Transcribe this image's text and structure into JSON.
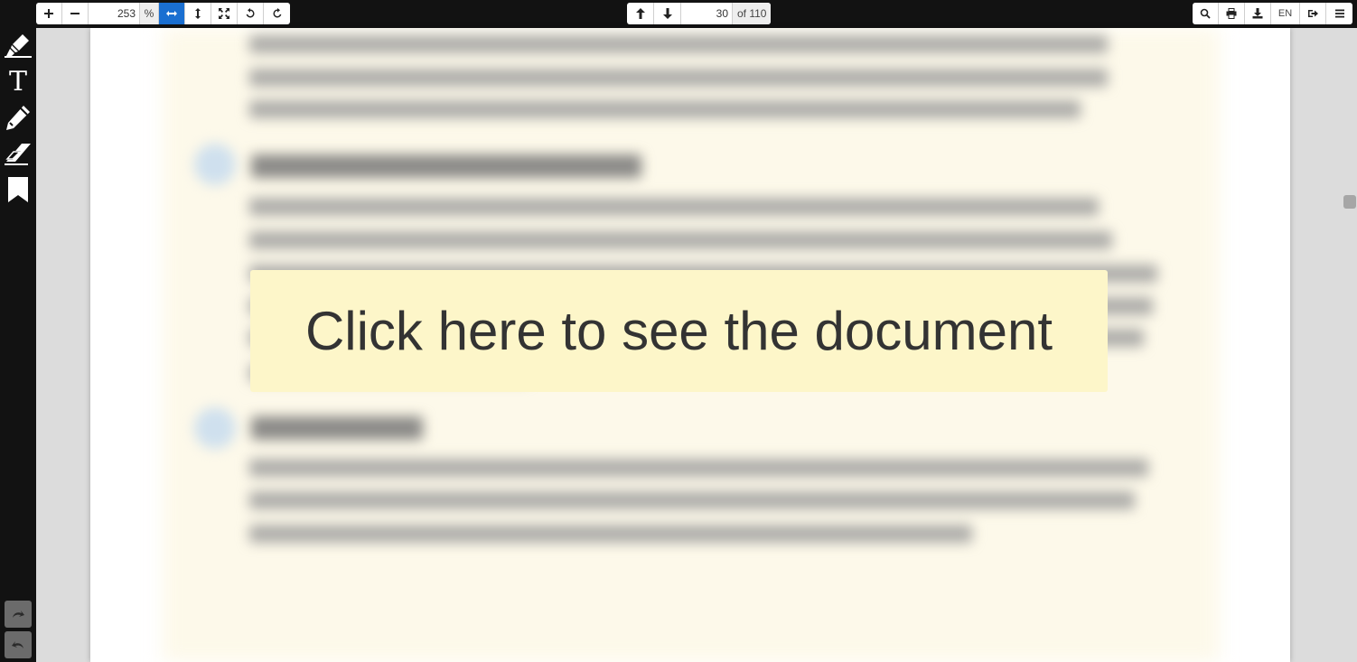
{
  "toolbar": {
    "zoom_in_icon": "plus-icon",
    "zoom_out_icon": "minus-icon",
    "zoom_value": "253",
    "zoom_unit": "%",
    "fit_width_icon": "fit-width-icon",
    "fit_height_icon": "fit-height-icon",
    "fullscreen_icon": "fullscreen-icon",
    "rotate_left_icon": "rotate-ccw-icon",
    "rotate_right_icon": "rotate-cw-icon",
    "prev_page_icon": "arrow-up-icon",
    "next_page_icon": "arrow-down-icon",
    "current_page": "30",
    "page_total": "of 110",
    "search_icon": "search-icon",
    "print_icon": "print-icon",
    "download_icon": "download-icon",
    "language": "EN",
    "exit_icon": "exit-icon",
    "menu_icon": "hamburger-menu-icon",
    "active_color": "#1a6fd1"
  },
  "sidebar": {
    "tools": [
      "highlighter-icon",
      "text-tool-icon",
      "pencil-icon",
      "eraser-icon",
      "bookmark-icon"
    ],
    "text_tool_glyph": "T",
    "redo_icon": "redo-icon",
    "undo_icon": "undo-icon"
  },
  "document": {
    "overlay_text": "Click here to see the document",
    "overlay_color": "#fdf6c9"
  }
}
